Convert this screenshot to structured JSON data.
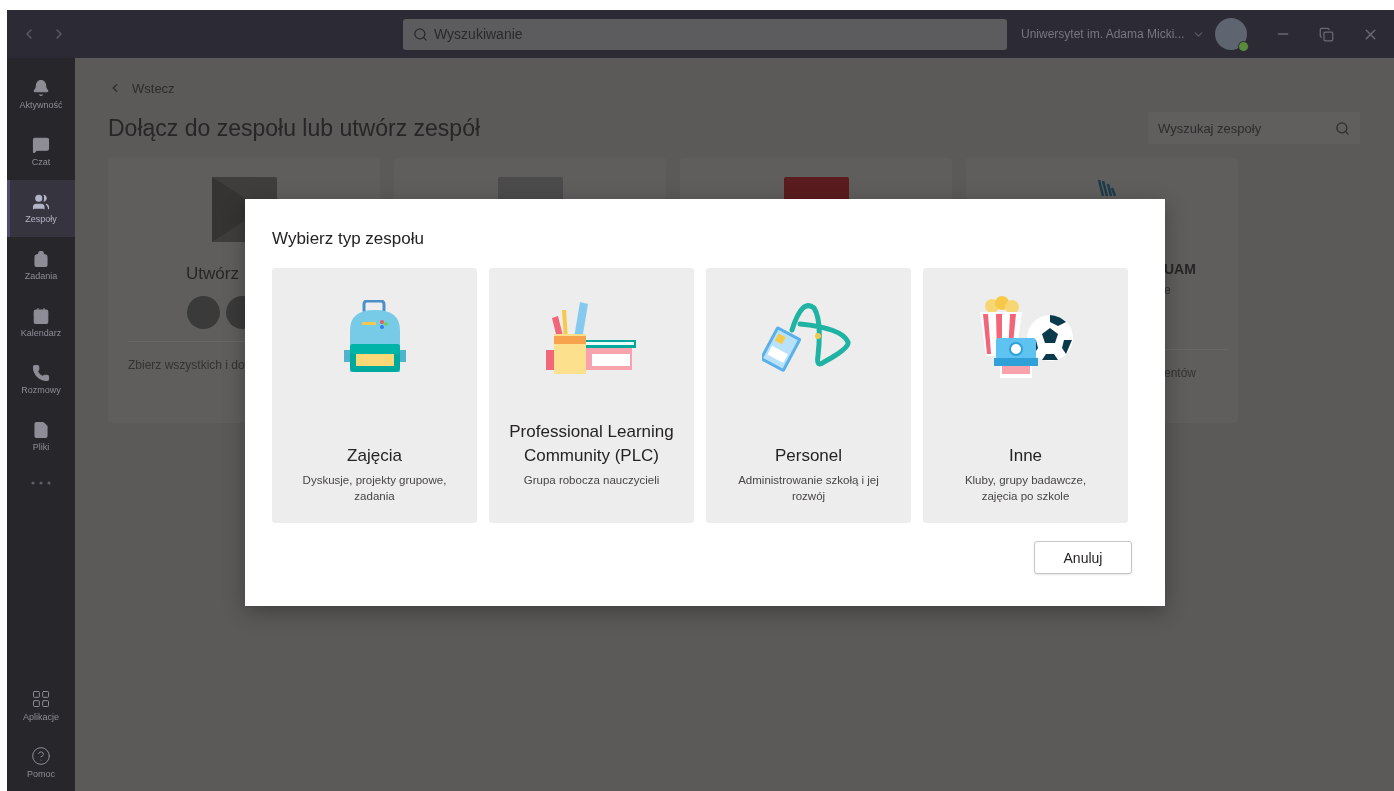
{
  "title_bar": {
    "search": {
      "placeholder": "Wyszukiwanie"
    },
    "organization": "Uniwersytet im. Adama Micki..."
  },
  "sidebar": {
    "items": [
      {
        "label": "Aktywność",
        "selected": false
      },
      {
        "label": "Czat",
        "selected": false
      },
      {
        "label": "Zespoły",
        "selected": true
      },
      {
        "label": "Zadania",
        "selected": false
      },
      {
        "label": "Kalendarz",
        "selected": false
      },
      {
        "label": "Rozmowy",
        "selected": false
      },
      {
        "label": "Pliki",
        "selected": false
      }
    ],
    "bottom_items": [
      {
        "label": "Aplikacje",
        "selected": false
      },
      {
        "label": "Pomoc",
        "selected": false
      }
    ]
  },
  "main": {
    "back": "Wstecz",
    "heading": "Dołącz do zespołu lub utwórz zespół",
    "team_search": {
      "placeholder": "Wyszukaj zespoły"
    },
    "cards": [
      {
        "kind": "create",
        "title": "Utwórz",
        "description": "Zbierz wszystkich i do"
      },
      {
        "kind": "plain",
        "color": "#4c4b4b"
      },
      {
        "kind": "plain",
        "color": "#5a1c1e"
      },
      {
        "kind": "team",
        "title": "UAM",
        "subtitle": "e",
        "footer": "entów"
      }
    ]
  },
  "dialog": {
    "title": "Wybierz typ zespołu",
    "options": [
      {
        "title": "Zajęcia",
        "description": "Dyskusje, projekty grupowe, zadania"
      },
      {
        "title": "Professional Learning Community (PLC)",
        "description": "Grupa robocza nauczycieli"
      },
      {
        "title": "Personel",
        "description": "Administrowanie szkołą i jej rozwój"
      },
      {
        "title": "Inne",
        "description": "Kluby, grupy badawcze, zajęcia po szkole"
      }
    ],
    "cancel": "Anuluj"
  }
}
